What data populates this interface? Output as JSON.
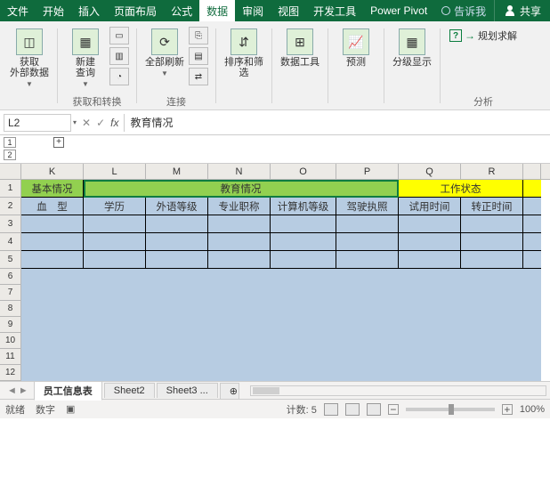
{
  "menu": {
    "file": "文件",
    "home": "开始",
    "insert": "插入",
    "pagelayout": "页面布局",
    "formulas": "公式",
    "data": "数据",
    "review": "审阅",
    "view": "视图",
    "dev": "开发工具",
    "powerpivot": "Power Pivot",
    "tellme": "告诉我",
    "share": "共享"
  },
  "ribbon": {
    "get_data": "获取\n外部数据",
    "new_query": "新建\n查询",
    "refresh_all": "全部刷新",
    "sort_filter": "排序和筛选",
    "data_tools": "数据工具",
    "forecast": "预测",
    "outline": "分级显示",
    "solver": "规划求解",
    "group_get": "获取和转换",
    "group_conn": "连接",
    "group_analysis": "分析"
  },
  "namebox": "L2",
  "formula": "教育情况",
  "outline_levels": [
    "1",
    "2"
  ],
  "columns": [
    "K",
    "L",
    "M",
    "N",
    "O",
    "P",
    "Q",
    "R"
  ],
  "row_numbers": [
    "1",
    "2",
    "3",
    "4",
    "5",
    "6",
    "7",
    "8",
    "9",
    "10",
    "11",
    "12"
  ],
  "categories": {
    "basic": "基本情况",
    "edu": "教育情况",
    "work": "工作状态"
  },
  "headers": {
    "K": "血　型",
    "L": "学历",
    "M": "外语等级",
    "N": "专业职称",
    "O": "计算机等级",
    "P": "驾驶执照",
    "Q": "试用时间",
    "R": "转正时间"
  },
  "tabs": {
    "t1": "员工信息表",
    "t2": "Sheet2",
    "t3": "Sheet3",
    "more": "...",
    "add": "⊕"
  },
  "status": {
    "ready": "就绪",
    "mode": "数字",
    "count_label": "计数:",
    "count_value": "5",
    "zoom": "100%"
  }
}
